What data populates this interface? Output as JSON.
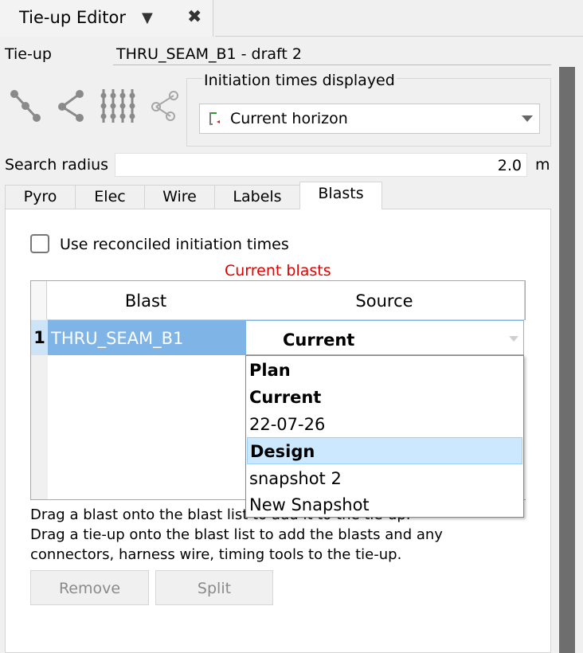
{
  "window": {
    "tab_title": "Tie-up Editor",
    "menu_glyph": "▼",
    "close_glyph": "✖"
  },
  "tieup": {
    "label": "Tie-up",
    "value": "THRU_SEAM_B1 - draft 2"
  },
  "toolbar": {
    "tools": [
      "connector-tool-icon",
      "branch-connector-tool-icon",
      "harness-wire-tool-icon",
      "timing-tool-icon"
    ]
  },
  "initiation": {
    "group_title": "Initiation times displayed",
    "selected": "Current horizon"
  },
  "search": {
    "label": "Search radius",
    "value": "2.0",
    "unit": "m"
  },
  "tabs": [
    {
      "label": "Pyro"
    },
    {
      "label": "Elec"
    },
    {
      "label": "Wire"
    },
    {
      "label": "Labels"
    },
    {
      "label": "Blasts"
    }
  ],
  "blasts_tab": {
    "reconcile_label": "Use reconciled initiation times",
    "section_title": "Current blasts",
    "table": {
      "columns": [
        "Blast",
        "Source"
      ],
      "rows": [
        {
          "index": "1",
          "blast": "THRU_SEAM_B1",
          "source": "Current"
        }
      ]
    },
    "source_options": [
      "Plan",
      "Current",
      "22-07-26",
      "Design",
      "snapshot 2",
      "New Snapshot"
    ],
    "help_lines": [
      "Drag a blast onto the blast list to add it to the tie-up.",
      "Drag a tie-up onto the blast list to add the blasts and any",
      "connectors, harness wire, timing tools to the tie-up."
    ],
    "buttons": {
      "remove": "Remove",
      "split": "Split"
    }
  },
  "colors": {
    "selection": "#7fb4e6",
    "highlight": "#cce8ff",
    "title_red": "#e00000"
  }
}
